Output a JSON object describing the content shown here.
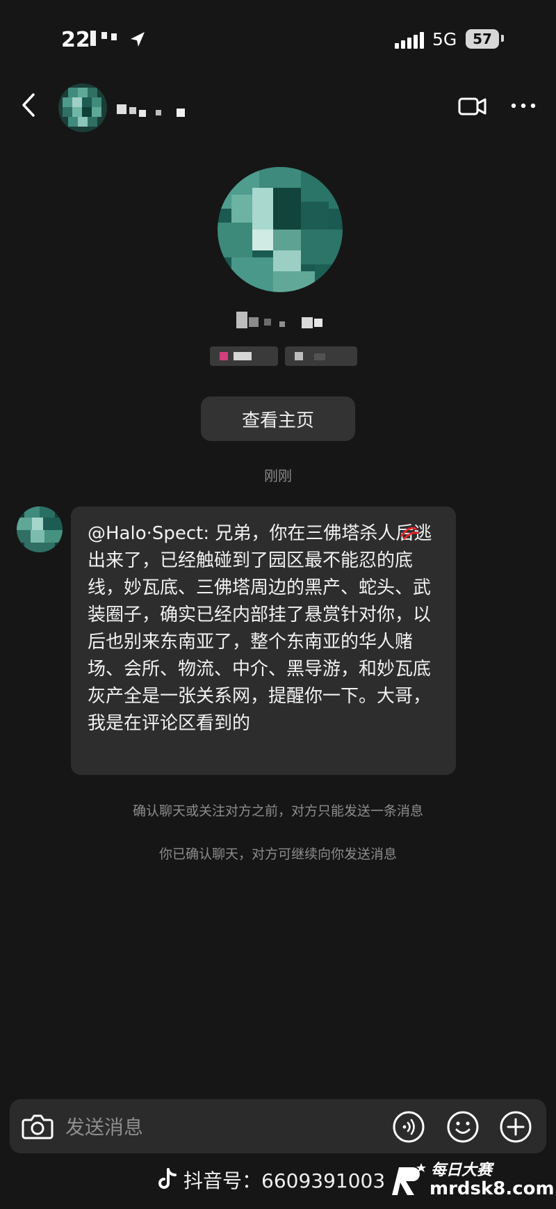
{
  "status_bar": {
    "time": "22",
    "network": "5G",
    "battery": "57"
  },
  "header": {
    "back_icon": "chevron-left-icon",
    "video_icon": "video-camera-icon",
    "more_icon": "more-horizontal-icon"
  },
  "profile": {
    "view_home_label": "查看主页"
  },
  "timestamp": "刚刚",
  "message": {
    "text": "@Halo·Spect: 兄弟，你在三佛塔杀人后逃出来了，已经触碰到了园区最不能忍的底线，妙瓦底、三佛塔周边的黑产、蛇头、武装圈子，确实已经内部挂了悬赏针对你，以后也别来东南亚了，整个东南亚的华人赌场、会所、物流、中介、黑导游，和妙瓦底灰产全是一张关系网，提醒你一下。大哥，我是在评论区看到的"
  },
  "system_notes": {
    "note1": "确认聊天或关注对方之前，对方只能发送一条消息",
    "note2": "你已确认聊天，对方可继续向你发送消息"
  },
  "input": {
    "placeholder": "发送消息"
  },
  "watermark": {
    "douyin": "抖音号：6609391003",
    "brand_top": "每日大赛",
    "brand_bottom": "mrdsk8.com"
  },
  "colors": {
    "background": "#161616",
    "bubble": "#2d2d2d",
    "button": "#333333",
    "avatar_teal": "#1f6e62"
  }
}
